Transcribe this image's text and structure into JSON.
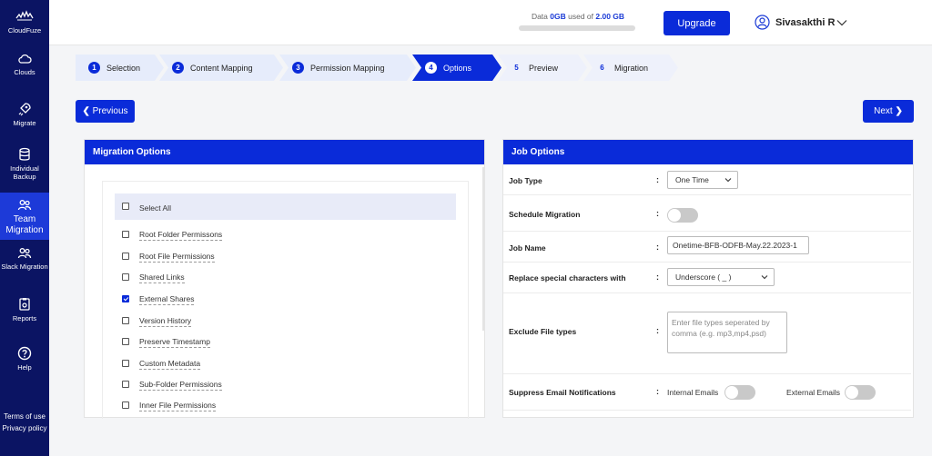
{
  "sidebar": {
    "brand": "CloudFuze",
    "items": [
      {
        "label": "Clouds",
        "icon": "cloud-icon"
      },
      {
        "label": "Migrate",
        "icon": "rocket-icon"
      },
      {
        "label": "Individual Backup",
        "icon": "database-icon"
      },
      {
        "label": "Team Migration",
        "icon": "team-icon",
        "active": true
      },
      {
        "label": "Slack Migration",
        "icon": "team-icon"
      },
      {
        "label": "Reports",
        "icon": "report-icon"
      },
      {
        "label": "Help",
        "icon": "help-icon"
      }
    ],
    "terms": "Terms of use",
    "privacy": "Privacy policy"
  },
  "header": {
    "data_prefix": "Data",
    "data_used": "0GB",
    "data_mid": "used of",
    "data_total": "2.00 GB",
    "usage_fraction": 0,
    "upgrade_label": "Upgrade",
    "user_name": "Sivasakthi R"
  },
  "steps": [
    {
      "num": "1",
      "label": "Selection",
      "state": "done"
    },
    {
      "num": "2",
      "label": "Content Mapping",
      "state": "done"
    },
    {
      "num": "3",
      "label": "Permission Mapping",
      "state": "done"
    },
    {
      "num": "4",
      "label": "Options",
      "state": "active"
    },
    {
      "num": "5",
      "label": "Preview",
      "state": "pending"
    },
    {
      "num": "6",
      "label": "Migration",
      "state": "pending"
    }
  ],
  "nav": {
    "previous": "Previous",
    "next": "Next"
  },
  "migration_options": {
    "title": "Migration Options",
    "select_all": "Select All",
    "items": [
      {
        "label": "Root Folder Permissons",
        "checked": false
      },
      {
        "label": "Root File Permissions",
        "checked": false
      },
      {
        "label": "Shared Links",
        "checked": false
      },
      {
        "label": "External Shares",
        "checked": true
      },
      {
        "label": "Version History",
        "checked": false
      },
      {
        "label": "Preserve Timestamp",
        "checked": false
      },
      {
        "label": "Custom Metadata",
        "checked": false
      },
      {
        "label": "Sub-Folder Permissions",
        "checked": false
      },
      {
        "label": "Inner File Permissions",
        "checked": false
      }
    ]
  },
  "job_options": {
    "title": "Job Options",
    "colon": ":",
    "job_type_label": "Job Type",
    "job_type_value": "One Time",
    "schedule_label": "Schedule Migration",
    "schedule_on": false,
    "job_name_label": "Job Name",
    "job_name_value": "Onetime-BFB-ODFB-May.22.2023-1",
    "replace_label": "Replace special characters with",
    "replace_value": "Underscore ( _ )",
    "exclude_label": "Exclude File types",
    "exclude_placeholder": "Enter file types seperated by comma (e.g. mp3,mp4,psd)",
    "suppress_label": "Suppress Email Notifications",
    "internal_label": "Internal Emails",
    "internal_on": false,
    "external_label": "External Emails",
    "external_on": false
  }
}
